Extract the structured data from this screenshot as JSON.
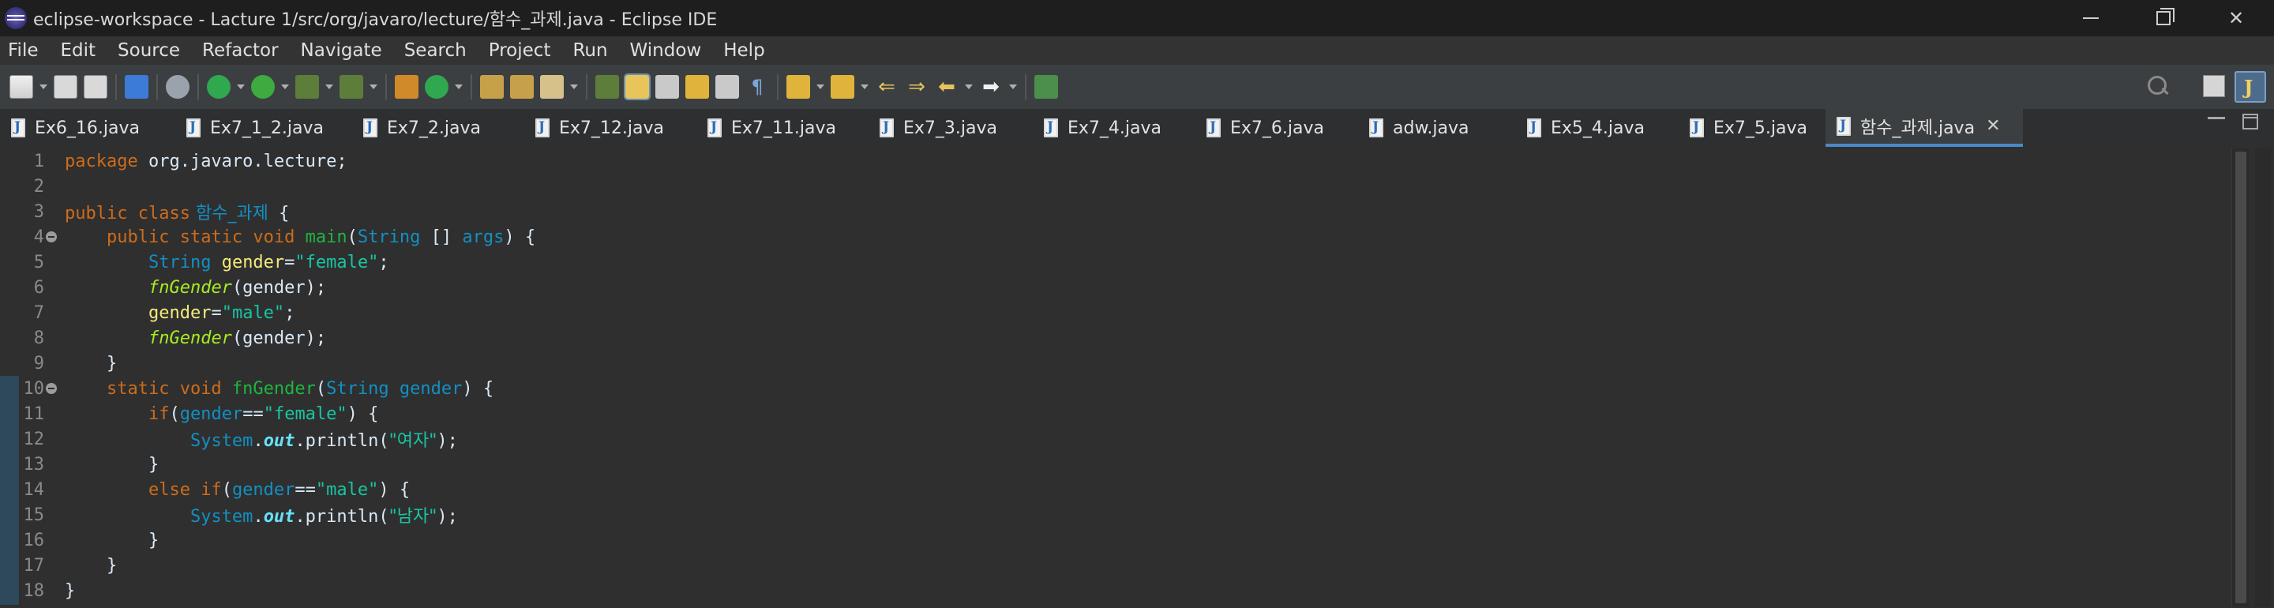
{
  "window": {
    "title": "eclipse-workspace - Lacture 1/src/org/javaro/lecture/함수_과제.java - Eclipse IDE"
  },
  "menu": [
    "File",
    "Edit",
    "Source",
    "Refactor",
    "Navigate",
    "Search",
    "Project",
    "Run",
    "Window",
    "Help"
  ],
  "tabs": [
    {
      "label": "Ex6_16.java",
      "active": false
    },
    {
      "label": "Ex7_1_2.java",
      "active": false
    },
    {
      "label": "Ex7_2.java",
      "active": false
    },
    {
      "label": "Ex7_12.java",
      "active": false
    },
    {
      "label": "Ex7_11.java",
      "active": false
    },
    {
      "label": "Ex7_3.java",
      "active": false
    },
    {
      "label": "Ex7_4.java",
      "active": false
    },
    {
      "label": "Ex7_6.java",
      "active": false
    },
    {
      "label": "adw.java",
      "active": false
    },
    {
      "label": "Ex5_4.java",
      "active": false
    },
    {
      "label": "Ex7_5.java",
      "active": false
    },
    {
      "label": "함수_과제.java",
      "active": true
    }
  ],
  "editor": {
    "line_numbers": [
      "1",
      "2",
      "3",
      "4",
      "5",
      "6",
      "7",
      "8",
      "9",
      "10",
      "11",
      "12",
      "13",
      "14",
      "15",
      "16",
      "17",
      "18"
    ],
    "tokens": {
      "l1_kw": "package",
      "l1_rest": " org.javaro.lecture;",
      "l3_kw1": "public",
      "l3_kw2": " class",
      "l3_cls": " 함수_과제",
      "l3_rest": " {",
      "l4_indent": "    ",
      "l4_kw": "public static void",
      "l4_fn": " main",
      "l4_p1": "(",
      "l4_ty": "String",
      "l4_p2": " [] ",
      "l4_var": "args",
      "l4_p3": ") {",
      "l5_indent": "        ",
      "l5_ty": "String",
      "l5_var": " gender",
      "l5_eq": "=",
      "l5_str": "\"female\"",
      "l5_end": ";",
      "l6_indent": "        ",
      "l6_call": "fnGender",
      "l6_rest": "(gender);",
      "l7_indent": "        ",
      "l7_var": "gender",
      "l7_eq": "=",
      "l7_str": "\"male\"",
      "l7_end": ";",
      "l8_indent": "        ",
      "l8_call": "fnGender",
      "l8_rest": "(gender);",
      "l9": "    }",
      "l10_indent": "    ",
      "l10_kw": "static void",
      "l10_fn": " fnGender",
      "l10_p1": "(",
      "l10_ty": "String",
      "l10_var": " gender",
      "l10_p2": ") {",
      "l11_indent": "        ",
      "l11_kw": "if",
      "l11_p1": "(",
      "l11_var": "gender",
      "l11_op": "==",
      "l11_str": "\"female\"",
      "l11_p2": ") {",
      "l12_indent": "            ",
      "l12_cls": "System",
      "l12_dot1": ".",
      "l12_field": "out",
      "l12_rest": ".println(",
      "l12_str": "\"여자\"",
      "l12_end": ");",
      "l13": "        }",
      "l14_indent": "        ",
      "l14_kw": "else if",
      "l14_p1": "(",
      "l14_var": "gender",
      "l14_op": "==",
      "l14_str": "\"male\"",
      "l14_p2": ") {",
      "l15_indent": "            ",
      "l15_cls": "System",
      "l15_dot1": ".",
      "l15_field": "out",
      "l15_rest": ".println(",
      "l15_str": "\"남자\"",
      "l15_end": ");",
      "l16": "        }",
      "l17": "    }",
      "l18": "}"
    }
  },
  "icons": {
    "app": "eclipse-icon",
    "search": "search-icon",
    "perspective_java": "java-perspective-icon",
    "open_perspective": "open-perspective-icon"
  }
}
